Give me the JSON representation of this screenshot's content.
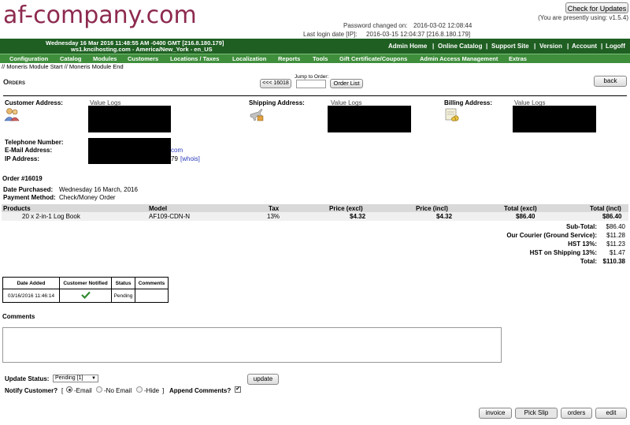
{
  "header": {
    "logo_text": "af-company.com",
    "check_updates_label": "Check for Updates",
    "version_note": "(You are presently using: v1.5.4)",
    "password_changed_label": "Password changed on:",
    "password_changed_value": "2016-03-02 12:08:44",
    "last_login_label": "Last login date [IP]:",
    "last_login_value": "2016-03-15 12:04:37 [216.8.180.179]",
    "datetime_line": "Wednesday 16 Mar 2016 11:48:55 AM -0400 GMT [216.8.180.179]",
    "host_line": "ws1.kncihosting.com - America/New_York - en_US",
    "top_links": [
      "Admin Home",
      "Online Catalog",
      "Support Site",
      "Version",
      "Account",
      "Logoff"
    ]
  },
  "menu": [
    "Configuration",
    "Catalog",
    "Modules",
    "Customers",
    "Locations / Taxes",
    "Localization",
    "Reports",
    "Tools",
    "Gift Certificate/Coupons",
    "Admin Access Management",
    "Extras"
  ],
  "module_line": "// Moneris Module Start // Moneris Module End",
  "page": {
    "title": "Orders",
    "prev_order_label": "<<< 16018",
    "jump_label": "Jump to Order:",
    "jump_value": "",
    "order_list_label": "Order List",
    "back_label": "back"
  },
  "addresses": {
    "customer_label": "Customer Address:",
    "shipping_label": "Shipping Address:",
    "billing_label": "Billing Address:",
    "customer_name": "Value Logs",
    "shipping_name": "Value Logs",
    "billing_name": "Value Logs"
  },
  "contact": {
    "phone_label": "Telephone Number:",
    "email_label": "E-Mail Address:",
    "ip_label": "IP Address:",
    "email_suffix": "com",
    "ip_suffix": "79",
    "whois_label": "[whois]"
  },
  "order": {
    "number": "Order #16019",
    "date_label": "Date Purchased:",
    "date_value": "Wednesday 16 March, 2016",
    "payment_label": "Payment Method:",
    "payment_value": "Check/Money Order"
  },
  "products": {
    "headers": [
      "Products",
      "Model",
      "Tax",
      "Price (excl)",
      "Price (incl)",
      "Total (excl)",
      "Total (incl)"
    ],
    "row": {
      "name": "20 x 2-in-1 Log Book",
      "model": "AF109-CDN-N",
      "tax": "13%",
      "price_excl": "$4.32",
      "price_incl": "$4.32",
      "total_excl": "$86.40",
      "total_incl": "$86.40"
    }
  },
  "totals": [
    {
      "label": "Sub-Total:",
      "value": "$86.40"
    },
    {
      "label": "Our Courier (Ground Service):",
      "value": "$11.28"
    },
    {
      "label": "HST 13%:",
      "value": "$11.23"
    },
    {
      "label": "HST on Shipping 13%:",
      "value": "$1.47"
    },
    {
      "label": "Total:",
      "value": "$110.38"
    }
  ],
  "history": {
    "headers": [
      "Date Added",
      "Customer Notified",
      "Status",
      "Comments"
    ],
    "row": {
      "date": "03/16/2016 11:46:14",
      "status": "Pending",
      "comments": ""
    }
  },
  "comments": {
    "label": "Comments",
    "value": ""
  },
  "update": {
    "status_label": "Update Status:",
    "status_value": "Pending [1]",
    "update_button": "update",
    "notify_label": "Notify Customer?",
    "notify_bracket_open": "[",
    "notify_bracket_close": "]",
    "email_option": "-Email",
    "noemail_option": "-No Email",
    "hide_option": "-Hide",
    "append_label": "Append Comments?"
  },
  "bottom_buttons": [
    "invoice",
    "Pick Slip",
    "orders",
    "edit"
  ],
  "colors": {
    "logo": "#8d2a4f",
    "topbar": "#1f5f22",
    "menubar": "#3f8e3c",
    "check": "#2e8b2e"
  }
}
